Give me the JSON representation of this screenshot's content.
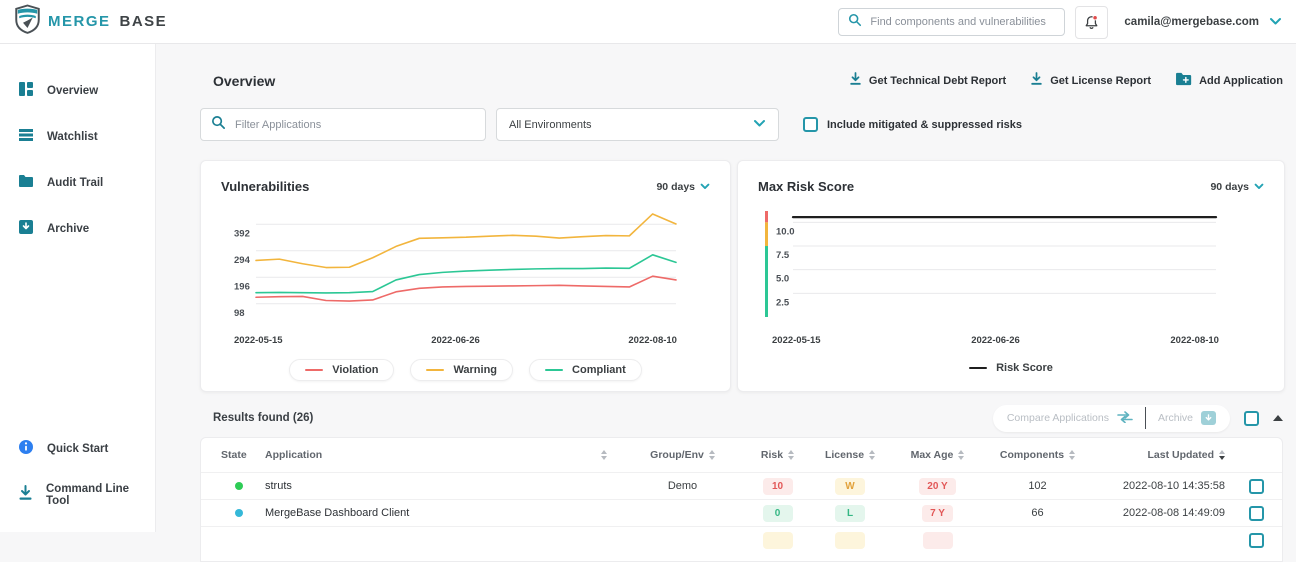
{
  "header": {
    "logo_merge": "MERGE",
    "logo_base": "BASE",
    "search_placeholder": "Find components and vulnerabilities",
    "user_email": "camila@mergebase.com"
  },
  "sidebar": {
    "items": [
      {
        "label": "Overview",
        "icon": "dashboard-icon"
      },
      {
        "label": "Watchlist",
        "icon": "list-icon"
      },
      {
        "label": "Audit Trail",
        "icon": "folder-icon"
      },
      {
        "label": "Archive",
        "icon": "archive-icon"
      }
    ],
    "bottom_items": [
      {
        "label": "Quick Start",
        "icon": "info-icon"
      },
      {
        "label": "Command Line Tool",
        "icon": "download-icon"
      }
    ]
  },
  "page": {
    "title": "Overview",
    "actions": [
      {
        "label": "Get Technical Debt Report",
        "icon": "download-icon"
      },
      {
        "label": "Get License Report",
        "icon": "download-icon"
      },
      {
        "label": "Add Application",
        "icon": "folder-plus-icon"
      }
    ],
    "filters": {
      "search_placeholder": "Filter Applications",
      "environment": "All Environments",
      "include_label": "Include mitigated & suppressed risks"
    }
  },
  "chart_data": [
    {
      "type": "line",
      "title": "Vulnerabilities",
      "range_label": "90 days",
      "x_labels": [
        "2022-05-15",
        "2022-06-26",
        "2022-08-10"
      ],
      "ylim": [
        49,
        441
      ],
      "yticks": [
        {
          "label": "392",
          "value": 392
        },
        {
          "label": "294",
          "value": 294
        },
        {
          "label": "196",
          "value": 196
        },
        {
          "label": "98",
          "value": 98
        }
      ],
      "grid": true,
      "legend_position": "bottom",
      "series": [
        {
          "name": "Violation",
          "color": "#ee6a68",
          "values": [
            122,
            124,
            125,
            110,
            108,
            112,
            142,
            155,
            160,
            162,
            163,
            164,
            165,
            166,
            164,
            162,
            160,
            200,
            186
          ]
        },
        {
          "name": "Warning",
          "color": "#f2b53d",
          "values": [
            258,
            263,
            246,
            232,
            233,
            268,
            310,
            340,
            342,
            344,
            348,
            351,
            348,
            341,
            346,
            350,
            349,
            430,
            393
          ]
        },
        {
          "name": "Compliant",
          "color": "#2cc795",
          "values": [
            139,
            140,
            139,
            138,
            139,
            143,
            186,
            206,
            214,
            219,
            222,
            225,
            227,
            228,
            228,
            230,
            229,
            279,
            251
          ]
        }
      ]
    },
    {
      "type": "line",
      "title": "Max Risk Score",
      "range_label": "90 days",
      "x_labels": [
        "2022-05-15",
        "2022-06-26",
        "2022-08-10"
      ],
      "ylim": [
        0,
        11.2
      ],
      "yticks": [
        {
          "label": "10.0",
          "value": 10
        },
        {
          "label": "7.5",
          "value": 7.5
        },
        {
          "label": "5.0",
          "value": 5
        },
        {
          "label": "2.5",
          "value": 2.5
        }
      ],
      "grid": true,
      "legend_position": "bottom",
      "bands": [
        {
          "from": 10,
          "to": 11.2,
          "color": "#ee6a68"
        },
        {
          "from": 7.5,
          "to": 10,
          "color": "#f2b53d"
        },
        {
          "from": 0,
          "to": 7.5,
          "color": "#2cc795"
        }
      ],
      "series": [
        {
          "name": "Risk Score",
          "color": "#1f1f1f",
          "width": 2.2,
          "values": [
            10.55,
            10.55
          ]
        }
      ]
    }
  ],
  "results": {
    "title": "Results found (26)",
    "toolbar": {
      "compare_label": "Compare Applications",
      "archive_label": "Archive"
    },
    "table": {
      "headers": {
        "state": "State",
        "application": "Application",
        "group": "Group/Env",
        "risk": "Risk",
        "license": "License",
        "max_age": "Max Age",
        "components": "Components",
        "last_updated": "Last Updated"
      },
      "rows": [
        {
          "state_color": "#2ecc56",
          "application": "struts",
          "group": "Demo",
          "risk": {
            "text": "10",
            "tone": "danger"
          },
          "license": {
            "text": "W",
            "tone": "warning"
          },
          "max_age": {
            "text": "20 Y",
            "tone": "danger"
          },
          "components": "102",
          "last_updated": "2022-08-10 14:35:58"
        },
        {
          "state_color": "#35b8d8",
          "application": "MergeBase Dashboard Client",
          "group": "",
          "risk": {
            "text": "0",
            "tone": "success"
          },
          "license": {
            "text": "L",
            "tone": "success"
          },
          "max_age": {
            "text": "7 Y",
            "tone": "danger"
          },
          "components": "66",
          "last_updated": "2022-08-08 14:49:09"
        },
        {
          "state_color": "",
          "application": "",
          "group": "",
          "risk": {
            "text": "",
            "tone": "warning"
          },
          "license": {
            "text": "",
            "tone": "warning"
          },
          "max_age": {
            "text": "",
            "tone": "danger"
          },
          "components": "",
          "last_updated": ""
        }
      ]
    }
  },
  "colors": {
    "accent_teal": "#2596a9",
    "icon_teal": "#1a7f93",
    "notification_red": "#e14b4b",
    "quickstart_blue": "#2d7ff0"
  }
}
